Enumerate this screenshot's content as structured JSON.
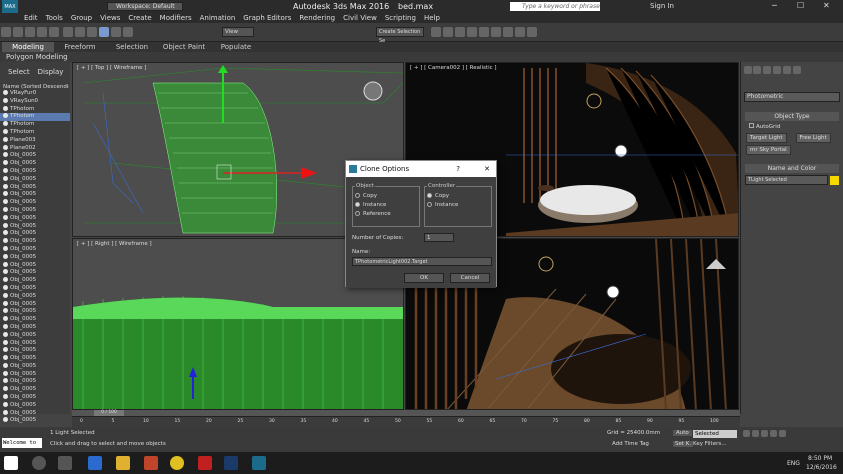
{
  "app": {
    "workspace": "Workspace: Default",
    "title": "Autodesk 3ds Max 2016",
    "file": "bed.max",
    "search_placeholder": "Type a keyword or phrase",
    "sign_in": "Sign In",
    "logo": "MAX"
  },
  "menu": [
    "Edit",
    "Tools",
    "Group",
    "Views",
    "Create",
    "Modifiers",
    "Animation",
    "Graph Editors",
    "Rendering",
    "Civil View",
    "Scripting",
    "Help"
  ],
  "toolbar": {
    "view_dropdown": "View",
    "selection_set": "Create Selection Se"
  },
  "ribbon": {
    "tabs": [
      "Modeling",
      "Freeform",
      "Selection",
      "Object Paint",
      "Populate"
    ],
    "active": "Modeling",
    "sub": "Polygon Modeling"
  },
  "scene": {
    "tabs": [
      "Select",
      "Display"
    ],
    "header": "Name (Sorted Descending)",
    "items": [
      "VRayFur0",
      "VRaySun0",
      "TPhotom",
      "TPhotom",
      "TPhotom",
      "TPhotom",
      "Plane003",
      "Plane002",
      "Obj_0005",
      "Obj_0005",
      "Obj_0005",
      "Obj_0005",
      "Obj_0005",
      "Obj_0005",
      "Obj_0005",
      "Obj_0005",
      "Obj_0005",
      "Obj_0005",
      "Obj_0005",
      "Obj_0005",
      "Obj_0005",
      "Obj_0005",
      "Obj_0005",
      "Obj_0005",
      "Obj_0005",
      "Obj_0005",
      "Obj_0005",
      "Obj_0005",
      "Obj_0005",
      "Obj_0005",
      "Obj_0005",
      "Obj_0005",
      "Obj_0005",
      "Obj_0005",
      "Obj_0005",
      "Obj_0005",
      "Obj_0005",
      "Obj_0005",
      "Obj_0005",
      "Obj_0005",
      "Obj_0005",
      "Obj_0005",
      "Obj_0005"
    ],
    "selected_index": 3
  },
  "viewports": {
    "top": "[ + ] [ Top ] [ Wireframe ]",
    "camera": "[ + ] [ Camera002 ] [ Realistic ]",
    "right": "[ + ] [ Right ] [ Wireframe ]",
    "perspective": ""
  },
  "command_panel": {
    "dropdown": "Photometric",
    "object_type": "Object Type",
    "autogrid": "AutoGrid",
    "target_light": "Target Light",
    "free_light": "Free Light",
    "sky_portal": "mr Sky Portal",
    "name_color": "Name and Color",
    "name_value": "TLight Selected",
    "swatch": "#f5d800"
  },
  "dialog": {
    "title": "Clone Options",
    "help": "?",
    "close": "✕",
    "object_label": "Object",
    "object_options": [
      "Copy",
      "Instance",
      "Reference"
    ],
    "object_selected": 1,
    "controller_label": "Controller",
    "controller_options": [
      "Copy",
      "Instance"
    ],
    "controller_selected": 0,
    "copies_label": "Number of Copies:",
    "copies_value": "1",
    "name_label": "Name:",
    "name_value": "TPhotometricLight002.Target",
    "ok": "OK",
    "cancel": "Cancel"
  },
  "timeline": {
    "frame": "0 / 100",
    "ticks": [
      "0",
      "5",
      "10",
      "15",
      "20",
      "25",
      "30",
      "35",
      "40",
      "45",
      "50",
      "55",
      "60",
      "65",
      "70",
      "75",
      "80",
      "85",
      "90",
      "95",
      "100"
    ]
  },
  "status": {
    "welcome": "Welcome to",
    "selected": "1 Light Selected",
    "hint": "Click and drag to select and move objects",
    "grid": "Grid = 25400.0mm",
    "time_tag": "Add Time Tag",
    "auto": "Auto",
    "set_key": "Set K.",
    "selected_dropdown": "Selected",
    "key_filters": "Key Filters..."
  },
  "taskbar": {
    "lang": "ENG",
    "time": "8:50 PM",
    "date": "12/6/2016"
  }
}
